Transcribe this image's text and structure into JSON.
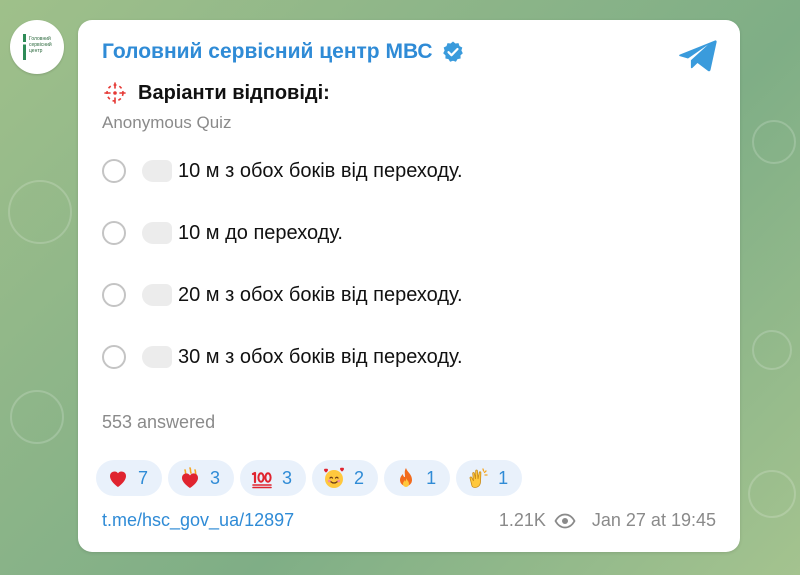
{
  "channel": {
    "name": "Головний сервісний центр МВС",
    "verified_icon": "verified-badge-icon",
    "avatar_text": "Головний сервісний центр"
  },
  "quiz": {
    "question": "Варіанти відповіді:",
    "question_icon": "quiz-sparkle-icon",
    "type": "Anonymous Quiz",
    "options": [
      {
        "text": "10 м з обох боків від переходу."
      },
      {
        "text": "10 м до переходу."
      },
      {
        "text": "20 м з обох боків від переходу."
      },
      {
        "text": "30 м з обох боків від переходу."
      }
    ],
    "answered": "553 answered"
  },
  "reactions": [
    {
      "icon": "red-heart-icon",
      "count": "7"
    },
    {
      "icon": "heart-on-fire-icon",
      "count": "3"
    },
    {
      "icon": "hundred-points-icon",
      "count": "3"
    },
    {
      "icon": "smiling-face-with-hearts-icon",
      "count": "2"
    },
    {
      "icon": "fire-icon",
      "count": "1"
    },
    {
      "icon": "clapping-hands-icon",
      "count": "1"
    }
  ],
  "footer": {
    "link": "t.me/hsc_gov_ua/12897",
    "views": "1.21K",
    "views_icon": "eye-icon",
    "date": "Jan 27 at 19:45"
  },
  "colors": {
    "accent": "#2f8bd6",
    "reaction_bg": "#e9f1fb",
    "muted_text": "#8a8a8a",
    "card_bg": "#ffffff",
    "background": "#8fb689"
  },
  "share_icon": "telegram-share-icon"
}
